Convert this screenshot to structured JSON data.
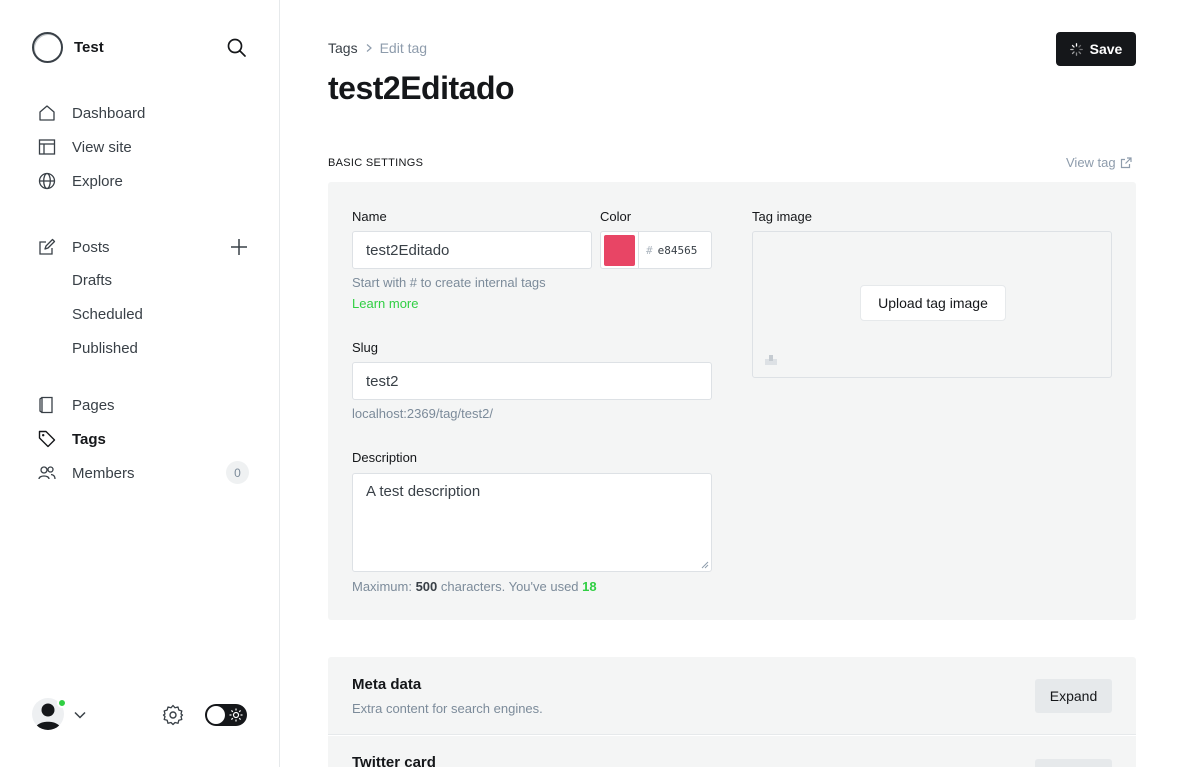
{
  "sidebar": {
    "site_name": "Test",
    "nav_main": [
      {
        "label": "Dashboard",
        "icon": "home-icon"
      },
      {
        "label": "View site",
        "icon": "layout-icon"
      },
      {
        "label": "Explore",
        "icon": "globe-icon"
      }
    ],
    "posts": {
      "label": "Posts",
      "icon": "edit-icon"
    },
    "post_subitems": [
      "Drafts",
      "Scheduled",
      "Published"
    ],
    "nav_secondary": [
      {
        "label": "Pages",
        "icon": "page-icon"
      },
      {
        "label": "Tags",
        "icon": "tag-icon"
      },
      {
        "label": "Members",
        "icon": "members-icon"
      }
    ],
    "members_count": "0",
    "active_item": "Tags",
    "online_dot_color": "#30cf43"
  },
  "header": {
    "breadcrumb_parent": "Tags",
    "breadcrumb_current": "Edit tag",
    "title": "test2Editado",
    "save_label": "Save"
  },
  "basic_settings": {
    "section_label": "BASIC SETTINGS",
    "view_tag_label": "View tag",
    "name_label": "Name",
    "name_value": "test2Editado",
    "name_hint": "Start with # to create internal tags",
    "learn_more": "Learn more",
    "color_label": "Color",
    "color_hash": "#",
    "color_value": "e84565",
    "color_hex": "#e84565",
    "slug_label": "Slug",
    "slug_value": "test2",
    "slug_url": "localhost:2369/tag/test2/",
    "description_label": "Description",
    "description_value": "A test description",
    "desc_hint_prefix": "Maximum:",
    "desc_hint_max": "500",
    "desc_hint_middle": "characters. You've used",
    "desc_hint_used": "18",
    "image_label": "Tag image",
    "upload_label": "Upload tag image"
  },
  "meta_data": {
    "title": "Meta data",
    "subtitle": "Extra content for search engines.",
    "expand_label": "Expand"
  },
  "twitter_card": {
    "title": "Twitter card"
  },
  "colors": {
    "accent_green": "#30cf43",
    "primary_dark": "#15171a",
    "panel_bg": "#f4f5f5"
  }
}
